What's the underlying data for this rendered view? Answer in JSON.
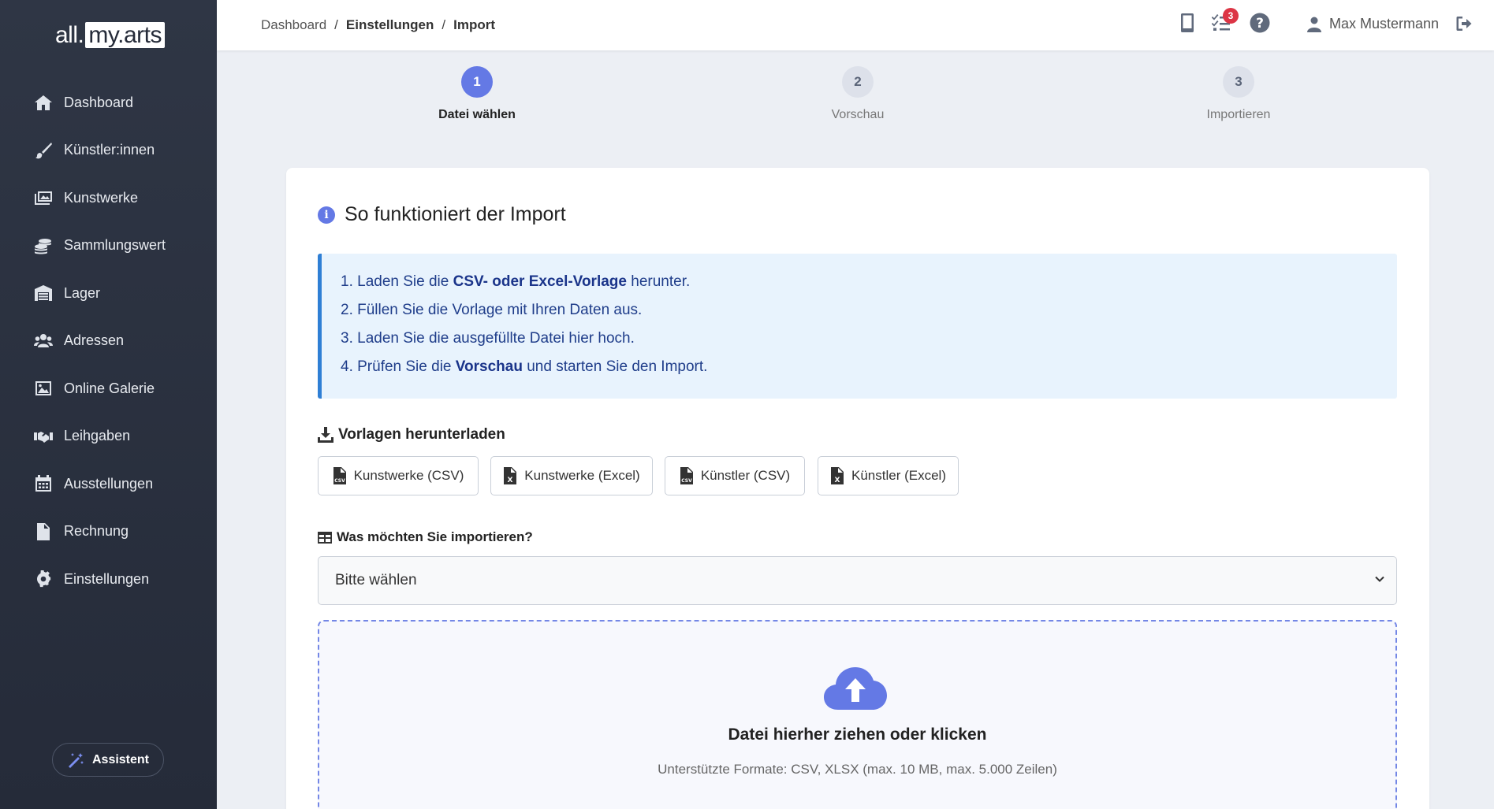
{
  "app": {
    "logo_part1": "all.",
    "logo_part2": "my.arts"
  },
  "sidebar": {
    "items": [
      {
        "label": "Dashboard",
        "icon": "home-icon"
      },
      {
        "label": "Künstler:innen",
        "icon": "brush-icon"
      },
      {
        "label": "Kunstwerke",
        "icon": "images-icon"
      },
      {
        "label": "Sammlungswert",
        "icon": "coins-icon"
      },
      {
        "label": "Lager",
        "icon": "warehouse-icon"
      },
      {
        "label": "Adressen",
        "icon": "users-icon"
      },
      {
        "label": "Online Galerie",
        "icon": "image-icon"
      },
      {
        "label": "Leihgaben",
        "icon": "handshake-icon"
      },
      {
        "label": "Ausstellungen",
        "icon": "calendar-icon"
      },
      {
        "label": "Rechnung",
        "icon": "invoice-icon"
      },
      {
        "label": "Einstellungen",
        "icon": "gear-icon"
      }
    ],
    "assistant_label": "Assistent"
  },
  "header": {
    "breadcrumb": {
      "item1": "Dashboard",
      "item2": "Einstellungen",
      "item3": "Import",
      "separator": "/"
    },
    "task_badge": "3",
    "user_name": "Max Mustermann"
  },
  "steps": [
    {
      "number": "1",
      "label": "Datei wählen",
      "state": "active"
    },
    {
      "number": "2",
      "label": "Vorschau",
      "state": "idle"
    },
    {
      "number": "3",
      "label": "Importieren",
      "state": "idle"
    }
  ],
  "card": {
    "title": "So funktioniert der Import",
    "info_icon_glyph": "i",
    "instructions": {
      "l1_pre": "1. Laden Sie die ",
      "l1_bold": "CSV- oder Excel-Vorlage",
      "l1_post": " herunter.",
      "l2": "2. Füllen Sie die Vorlage mit Ihren Daten aus.",
      "l3": "3. Laden Sie die ausgefüllte Datei hier hoch.",
      "l4_pre": "4. Prüfen Sie die ",
      "l4_bold": "Vorschau",
      "l4_post": " und starten Sie den Import."
    },
    "templates_heading": "Vorlagen herunterladen",
    "template_buttons": [
      {
        "label": "Kunstwerke (CSV)",
        "icon": "file-csv-icon"
      },
      {
        "label": "Kunstwerke (Excel)",
        "icon": "file-excel-icon"
      },
      {
        "label": "Künstler (CSV)",
        "icon": "file-csv-icon"
      },
      {
        "label": "Künstler (Excel)",
        "icon": "file-excel-icon"
      }
    ],
    "import_type_label": "Was möchten Sie importieren?",
    "import_type_selected": "Bitte wählen",
    "dropzone": {
      "title": "Datei hierher ziehen oder klicken",
      "subtitle": "Unterstützte Formate: CSV, XLSX (max. 10 MB, max. 5.000 Zeilen)"
    }
  },
  "colors": {
    "sidebar_bg": "#2a3040",
    "accent": "#6479e5",
    "badge": "#dc3545",
    "info_bg": "#e8f3fd",
    "info_border": "#2f7fd5"
  }
}
